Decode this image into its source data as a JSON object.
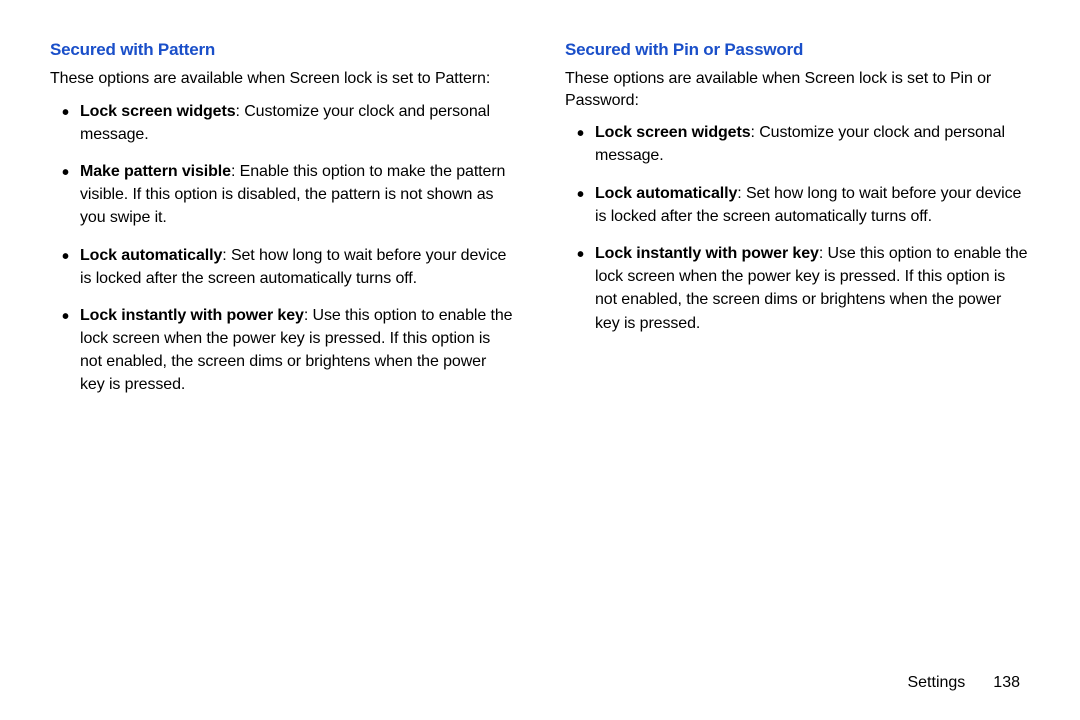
{
  "left": {
    "heading": "Secured with Pattern",
    "intro": "These options are available when Screen lock is set to Pattern:",
    "items": [
      {
        "label": "Lock screen widgets",
        "desc": ": Customize your clock and personal message."
      },
      {
        "label": "Make pattern visible",
        "desc": ": Enable this option to make the pattern visible. If this option is disabled, the pattern is not shown as you swipe it."
      },
      {
        "label": "Lock automatically",
        "desc": ": Set how long to wait before your device is locked after the screen automatically turns off."
      },
      {
        "label": "Lock instantly with power key",
        "desc": ": Use this option to enable the lock screen when the power key is pressed. If this option is not enabled, the screen dims or brightens when the power key is pressed."
      }
    ]
  },
  "right": {
    "heading": "Secured with Pin or Password",
    "intro": "These options are available when Screen lock is set to Pin or Password:",
    "items": [
      {
        "label": "Lock screen widgets",
        "desc": ": Customize your clock and personal message."
      },
      {
        "label": "Lock automatically",
        "desc": ": Set how long to wait before your device is locked after the screen automatically turns off."
      },
      {
        "label": "Lock instantly with power key",
        "desc": ": Use this option to enable the lock screen when the power key is pressed. If this option is not enabled, the screen dims or brightens when the power key is pressed."
      }
    ]
  },
  "footer": {
    "section": "Settings",
    "page": "138"
  }
}
